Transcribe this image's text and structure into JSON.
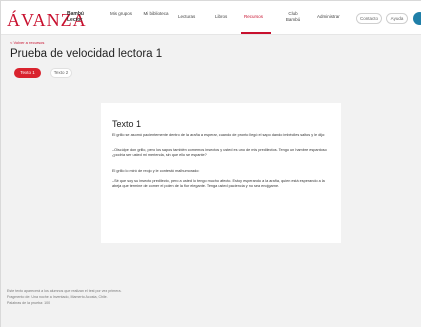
{
  "header": {
    "logo": "ÁVANZA",
    "logo_subtitle": "Bambú Lector",
    "nav": [
      {
        "label": "Mis grupos"
      },
      {
        "label": "Mi biblioteca"
      },
      {
        "label": "Lecturas"
      },
      {
        "label": "Libros"
      },
      {
        "label": "Recursos"
      },
      {
        "label": "Club Bambú"
      },
      {
        "label": "Administrar"
      }
    ],
    "contact_label": "Contacto",
    "help_label": "Ayuda"
  },
  "page": {
    "back_link": "< Volver a recursos",
    "title": "Prueba de velocidad lectora 1",
    "tabs": [
      {
        "label": "Texto 1",
        "active": true
      },
      {
        "label": "Texto 2",
        "active": false
      }
    ]
  },
  "content": {
    "title": "Texto 1",
    "paragraphs": [
      "El grillo se asomó pacientemente dentro de la araña a esperar, cuando de pronto llegó el sapo dando imbéciles saltos y le dijo:",
      "–Oiscúlpe don grillo, pero los sapos también comemos insectos y usted es uno de mis predilectos. Tengo un hambre espantoso ¿podría ser usted mi merienda, sin que ello se espante?",
      "El grillo lo miró de reojo y le contestó malhumorado:",
      "–Sé que soy su insecto predilecto, pero a usted lo tengo mucho afecto. Estoy esperando a la araña, quien está esperando a la abeja que termine de comer el polen de la flor elegante. Tenga usted paciencia y no sea enojgarne."
    ]
  },
  "footer": {
    "notes": [
      "Este texto aparecerá a los alumnos que realizan el test por vez primera.",
      "Fragmento de: Una noche a Inventado, Mamerto Acosta, Chile.",
      "Palabras de la prueba: 100"
    ]
  },
  "colors": {
    "accent": "#c8102e",
    "tab_active": "#d9232e",
    "avatar": "#1f7fa8"
  }
}
